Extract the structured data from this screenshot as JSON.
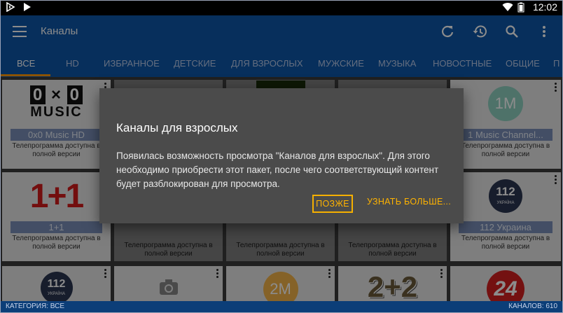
{
  "status_bar": {
    "time": "12:02"
  },
  "app_bar": {
    "title": "Каналы"
  },
  "tabs": [
    {
      "label": "ВСЕ"
    },
    {
      "label": "HD"
    },
    {
      "label": "ИЗБРАННОЕ"
    },
    {
      "label": "ДЕТСКИЕ"
    },
    {
      "label": "ДЛЯ ВЗРОСЛЫХ"
    },
    {
      "label": "МУЖСКИЕ"
    },
    {
      "label": "МУЗЫКА"
    },
    {
      "label": "НОВОСТНЫЕ"
    },
    {
      "label": "ОБЩИЕ"
    },
    {
      "label": "П"
    }
  ],
  "channels": [
    {
      "name": "0x0 Music HD",
      "logo": "0×0 MUSIC",
      "sub": "Телепрограмма доступна в полной версии"
    },
    {
      "name": "1 Music Channel...",
      "logo": "1M",
      "sub": "Телепрограмма доступна в полной версии"
    },
    {
      "name": "1+1",
      "logo": "1+1",
      "sub": "Телепрограмма доступна в полной версии"
    },
    {
      "name": "112 Украина",
      "logo": "112",
      "logo_sub": "УКРАЇНА",
      "sub": "Телепрограмма доступна в полной версии"
    },
    {
      "logo": "112",
      "logo_sub": "УКРАЇНА"
    },
    {
      "logo": "2M"
    },
    {
      "logo": "2+2"
    },
    {
      "logo": "24"
    }
  ],
  "bg_sub": "Телепрограмма доступна в полной версии",
  "bottom_bar": {
    "category": "КАТЕГОРИЯ: ВСЕ",
    "count": "КАНАЛОВ: 610"
  },
  "dialog": {
    "title": "Каналы для взрослых",
    "body": "Появилась возможность просмотра \"Каналов для взрослых\". Для этого необходимо приобрести этот пакет, после чего соответствующий контент будет разблокирован для просмотра.",
    "later_label": "ПОЗЖЕ",
    "more_label": "УЗНАТЬ БОЛЬШЕ..."
  },
  "colors": {
    "primary": "#0d57a8",
    "accent": "#ff9800",
    "dialog_bg": "#4b4b4b"
  }
}
